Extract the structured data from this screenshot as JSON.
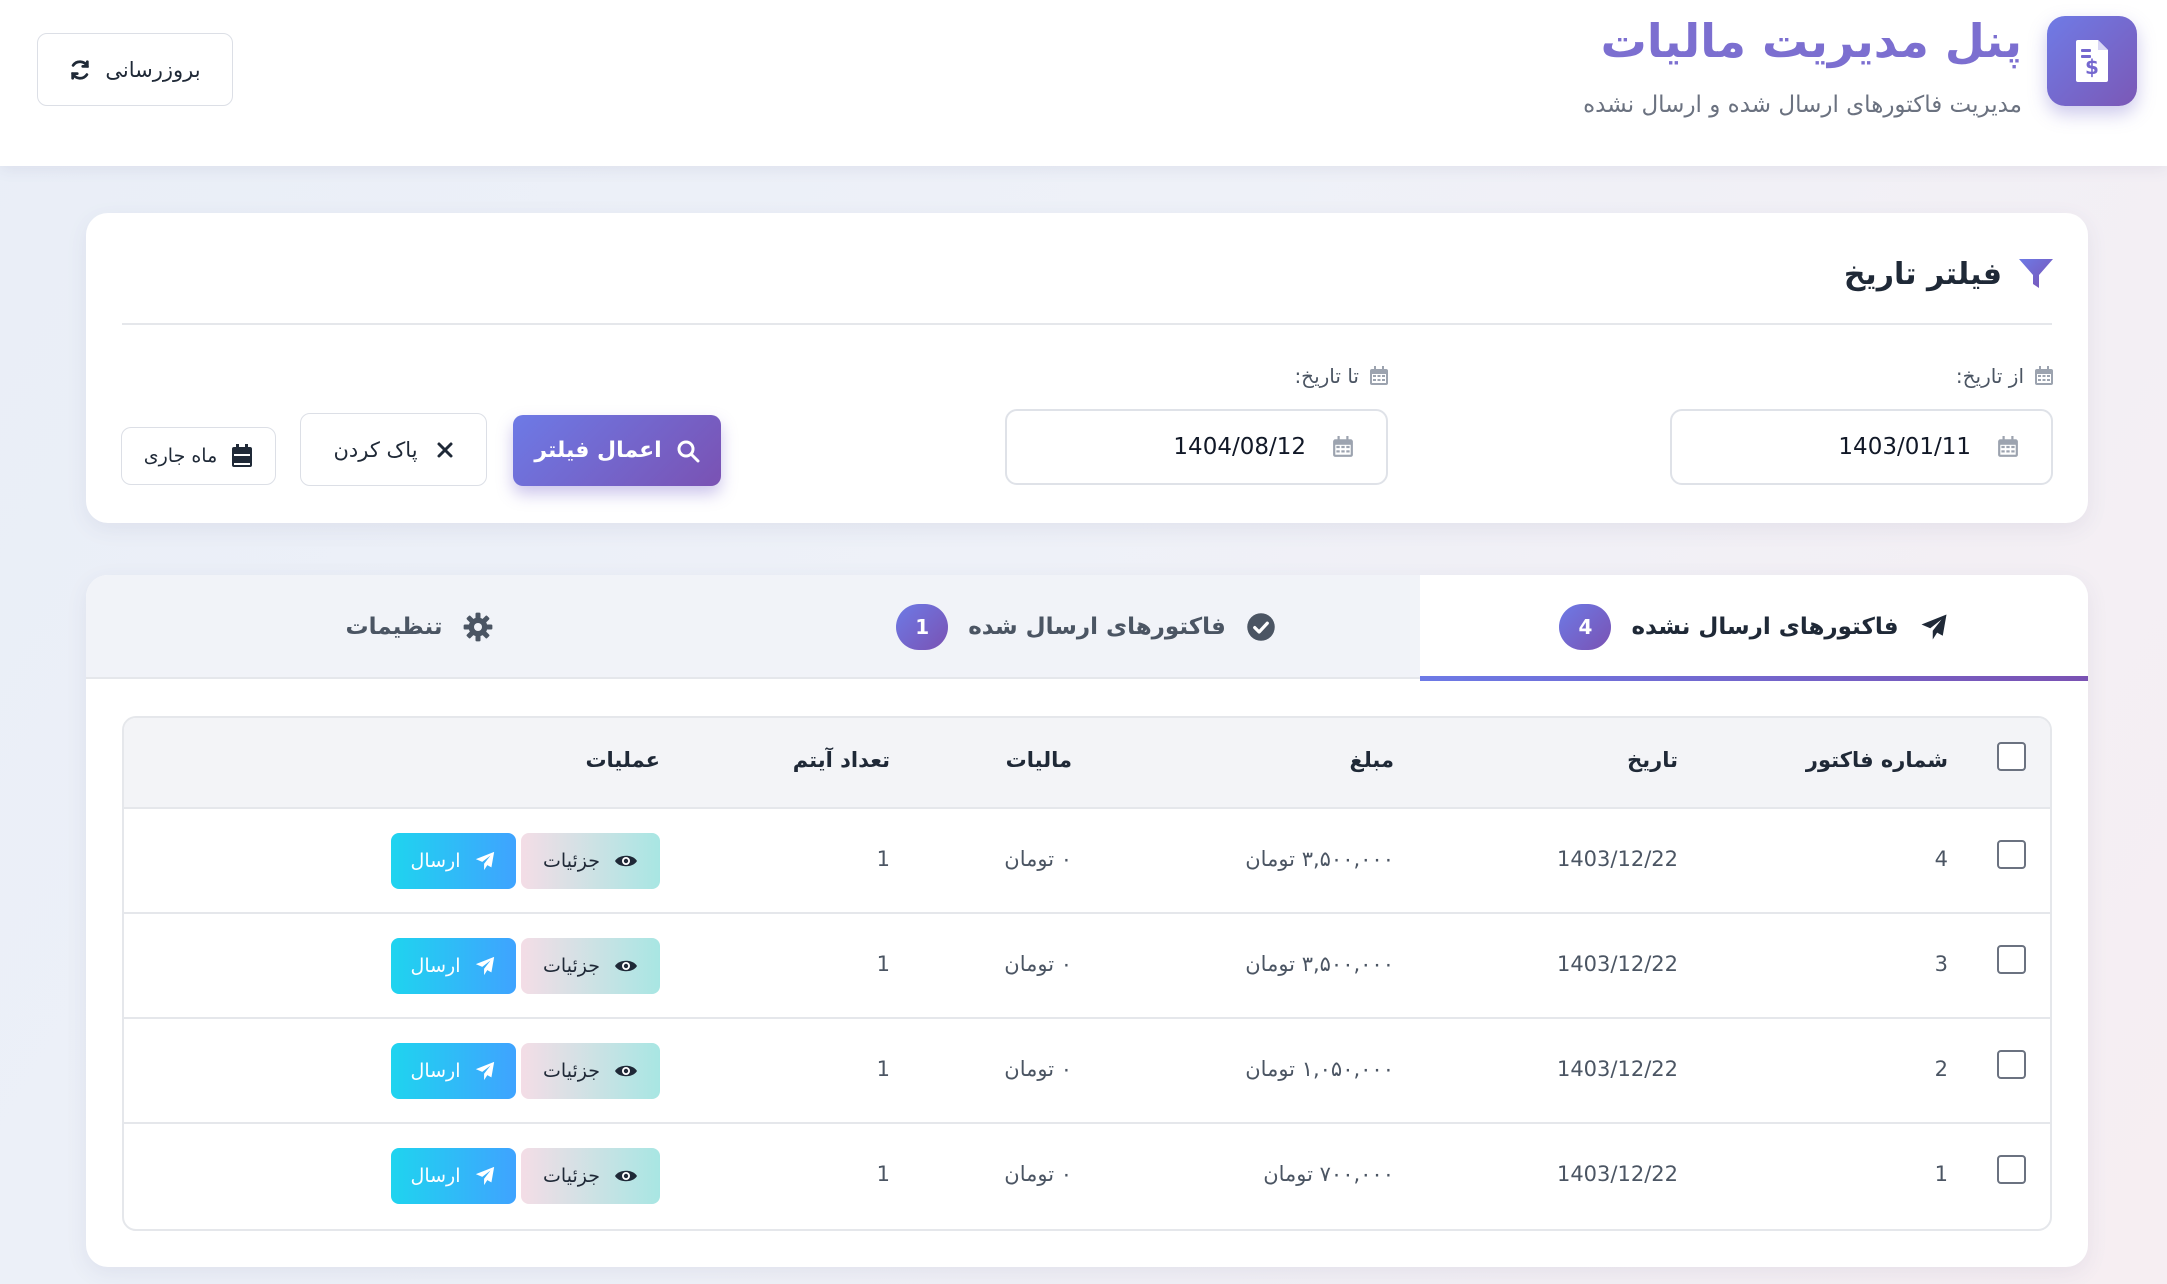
{
  "header": {
    "title": "پنل مدیریت مالیات",
    "subtitle": "مدیریت فاکتورهای ارسال شده و ارسال نشده",
    "refresh_label": "بروزرسانی"
  },
  "filter": {
    "title": "فیلتر تاریخ",
    "from_label": "از تاریخ:",
    "from_value": "1403/01/11",
    "to_label": "تا تاریخ:",
    "to_value": "1404/08/12",
    "apply_label": "اعمال فیلتر",
    "clear_label": "پاک کردن",
    "current_month_label": "ماه جاری"
  },
  "tabs": [
    {
      "label": "فاکتورهای ارسال نشده",
      "count": "4",
      "icon": "paper-plane-icon",
      "active": true
    },
    {
      "label": "فاکتورهای ارسال شده",
      "count": "1",
      "icon": "check-circle-icon",
      "active": false
    },
    {
      "label": "تنظیمات",
      "icon": "gear-icon",
      "active": false
    }
  ],
  "table": {
    "headers": {
      "number": "شماره فاکتور",
      "date": "تاریخ",
      "amount": "مبلغ",
      "tax": "مالیات",
      "items": "تعداد آیتم",
      "actions": "عملیات"
    },
    "rows": [
      {
        "number": "4",
        "date": "1403/12/22",
        "amount": "۳,۵۰۰,۰۰۰ تومان",
        "tax": "۰ تومان",
        "items": "1"
      },
      {
        "number": "3",
        "date": "1403/12/22",
        "amount": "۳,۵۰۰,۰۰۰ تومان",
        "tax": "۰ تومان",
        "items": "1"
      },
      {
        "number": "2",
        "date": "1403/12/22",
        "amount": "۱,۰۵۰,۰۰۰ تومان",
        "tax": "۰ تومان",
        "items": "1"
      },
      {
        "number": "1",
        "date": "1403/12/22",
        "amount": "۷۰۰,۰۰۰ تومان",
        "tax": "۰ تومان",
        "items": "1"
      }
    ],
    "details_label": "جزئیات",
    "send_label": "ارسال"
  },
  "colors": {
    "accent_start": "#6d7ae6",
    "accent_end": "#7a52b3",
    "send_start": "#3fa3ff",
    "send_end": "#1fd4ef"
  }
}
